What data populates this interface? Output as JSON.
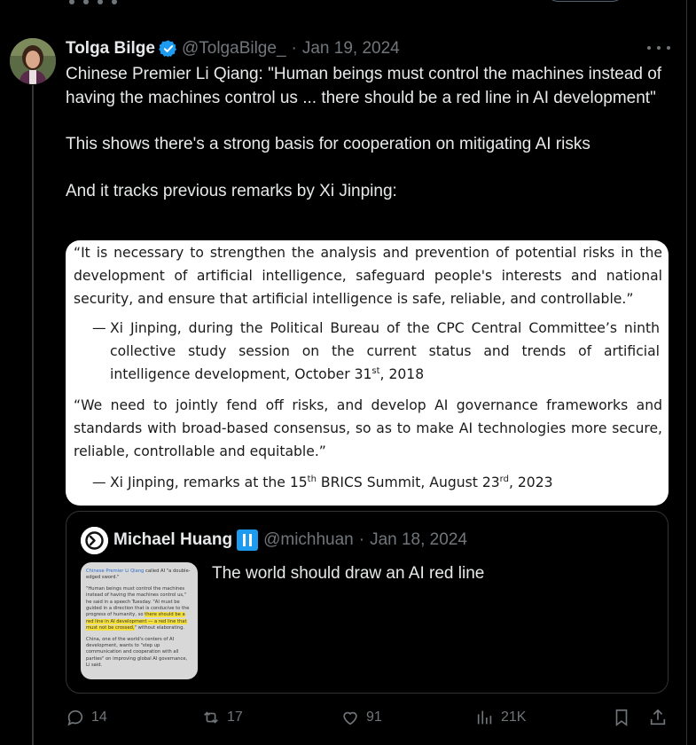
{
  "tweet": {
    "author_name": "Tolga Bilge",
    "handle": "@TolgaBilge_",
    "separator": "·",
    "date": "Jan 19, 2024",
    "paragraphs": [
      "Chinese Premier Li Qiang: \"Human beings must control the machines instead of having the machines control us ... there should be a red line in AI development\"",
      "This shows there's a strong basis for cooperation on mitigating AI risks",
      "And it tracks previous remarks by Xi Jinping:"
    ]
  },
  "media": {
    "quote1": "“It is necessary to strengthen the analysis and prevention of potential risks in the development of artificial intelligence, safeguard people's interests and national security, and ensure that artificial intelligence is safe, reliable, and controllable.”",
    "attr1_dash": "—",
    "attr1_text": "Xi Jinping, during the Political Bureau of the CPC Central Committee’s ninth collective study session on the current status and trends of artificial intelligence development, October 31",
    "attr1_sup": "st",
    "attr1_tail": ", 2018",
    "quote2": "“We need to jointly fend off risks, and develop AI governance frameworks and standards with broad-based consensus, so as to make AI technologies more secure, reliable, controllable and equitable.”",
    "attr2_dash": "—",
    "attr2_text": "Xi Jinping, remarks at the 15",
    "attr2_sup1": "th",
    "attr2_mid": " BRICS Summit, August 23",
    "attr2_sup2": "rd",
    "attr2_tail": ", 2023"
  },
  "quoted": {
    "author_name": "Michael Huang",
    "handle": "@michhuan",
    "separator": "·",
    "date": "Jan 18, 2024",
    "text": "The world should draw an AI red line",
    "thumb": {
      "p1_link": "Chinese Premier Li Qiang",
      "p1_rest": " called AI \"a double-edged sword.\"",
      "p2_a": "\"Human beings must control the machines instead of having the machines control us,\" he said in a speech Tuesday. \"AI must be guided in a direction that is conducive to the progress of humanity, so ",
      "p2_hl": "there should be a red line in AI development — a red line that must not be crossed,",
      "p2_b": "\" without elaborating.",
      "p3": "China, one of the world's centers of AI development, wants to \"step up communication and cooperation with all parties\" on improving global AI governance, Li said."
    }
  },
  "actions": {
    "replies": "14",
    "reposts": "17",
    "likes": "91",
    "views": "21K"
  },
  "colors": {
    "background": "#000000",
    "text": "#e7e9ea",
    "muted": "#71767b",
    "verified": "#1d9bf0",
    "border": "#2f3336"
  }
}
